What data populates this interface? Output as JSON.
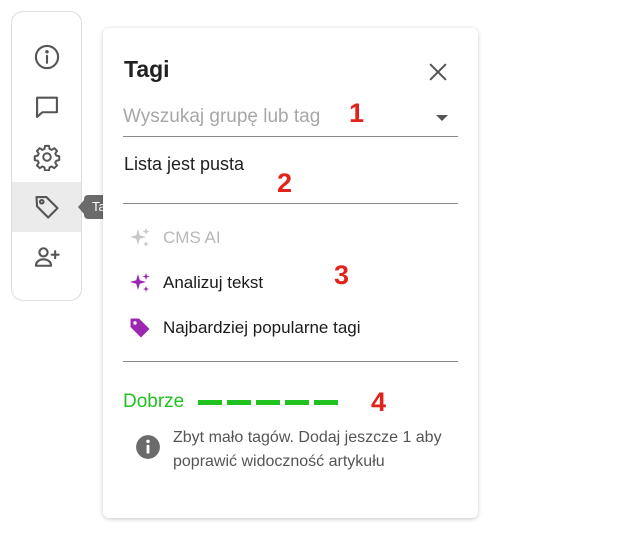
{
  "rail": {
    "items": [
      {
        "name": "info",
        "icon": "info-icon"
      },
      {
        "name": "comments",
        "icon": "comment-icon"
      },
      {
        "name": "settings",
        "icon": "gear-icon"
      },
      {
        "name": "tags",
        "icon": "tag-icon",
        "active": true
      },
      {
        "name": "add-user",
        "icon": "add-user-icon"
      }
    ],
    "tooltip": "Tagi"
  },
  "panel": {
    "title": "Tagi",
    "search": {
      "placeholder": "Wyszukaj grupę lub tag",
      "value": ""
    },
    "empty_text": "Lista jest pusta",
    "actions": [
      {
        "label": "CMS AI",
        "icon": "sparkles-icon",
        "enabled": false
      },
      {
        "label": "Analizuj tekst",
        "icon": "sparkles-icon",
        "enabled": true
      },
      {
        "label": "Najbardziej popularne tagi",
        "icon": "tag-filled-icon",
        "enabled": true
      }
    ],
    "quality": {
      "label": "Dobrze",
      "filled_segments": 5,
      "total_segments": 5,
      "color": "#1fc21f"
    },
    "hint": "Zbyt mało tagów. Dodaj jeszcze 1 aby poprawić widoczność artykułu"
  },
  "annotations": [
    "1",
    "2",
    "3",
    "4"
  ],
  "colors": {
    "accent_purple": "#9c27b0",
    "success_green": "#1fc21f",
    "marker_red": "#e1231c"
  }
}
